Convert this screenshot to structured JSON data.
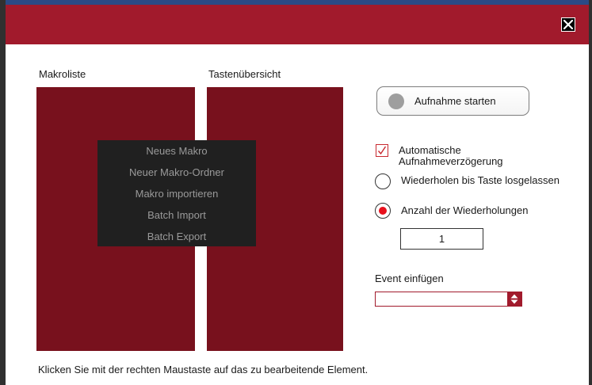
{
  "window": {
    "close_icon": "close-icon",
    "accent_color": "#a11a2c",
    "panel_color": "#78111d"
  },
  "macro_list": {
    "label": "Makroliste"
  },
  "key_overview": {
    "label": "Tastenübersicht"
  },
  "context_menu": {
    "items": [
      "Neues Makro",
      "Neuer Makro-Ordner",
      "Makro importieren",
      "Batch Import",
      "Batch Export"
    ]
  },
  "recording": {
    "button_label": "Aufnahme starten",
    "icon": "record-icon"
  },
  "options": {
    "auto_delay_label": "Automatische Aufnahmeverzögerung",
    "auto_delay_checked": true,
    "repeat_until_release_label": "Wiederholen bis Taste losgelassen",
    "repeat_until_release_selected": false,
    "repeat_count_label": "Anzahl der Wiederholungen",
    "repeat_count_selected": true,
    "repeat_count_value": "1"
  },
  "event": {
    "label": "Event einfügen",
    "selected_value": "",
    "spinner_icon": "up-down-arrows-icon"
  },
  "footer": {
    "hint": "Klicken Sie mit der rechten Maustaste auf das zu bearbeitende Element."
  }
}
